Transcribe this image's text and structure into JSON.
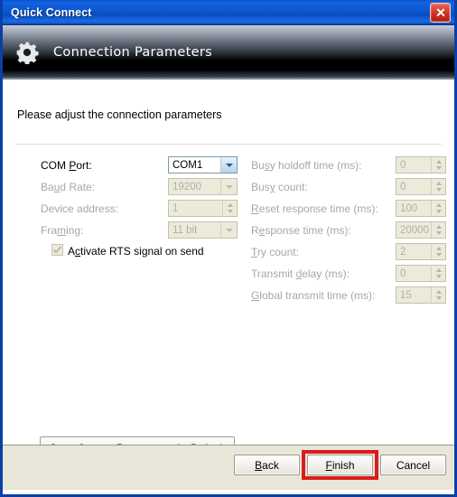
{
  "window": {
    "title": "Quick Connect",
    "close_icon": "close-icon"
  },
  "banner": {
    "icon": "gear-icon",
    "title": "Connection Parameters"
  },
  "intro": "Please adjust the connection parameters",
  "left_fields": [
    {
      "label_pre": "COM ",
      "label_acc": "P",
      "label_post": "ort:",
      "value": "COM1",
      "widget": "combo",
      "enabled": true
    },
    {
      "label_pre": "Ba",
      "label_acc": "u",
      "label_post": "d Rate:",
      "value": "19200",
      "widget": "combo",
      "enabled": false
    },
    {
      "label_pre": "Device address:",
      "label_acc": "",
      "label_post": "",
      "value": "1",
      "widget": "spinner",
      "enabled": false
    },
    {
      "label_pre": "Fra",
      "label_acc": "m",
      "label_post": "ing:",
      "value": "11 bit",
      "widget": "combo",
      "enabled": false
    }
  ],
  "checkbox": {
    "label_pre": "A",
    "label_acc": "c",
    "label_post": "tivate RTS signal on send",
    "checked": true,
    "enabled": false
  },
  "right_fields": [
    {
      "label_pre": "Bu",
      "label_acc": "s",
      "label_post": "y holdoff time (ms):",
      "value": "0",
      "widget": "spinner",
      "enabled": false
    },
    {
      "label_pre": "Bus",
      "label_acc": "y",
      "label_post": " count:",
      "value": "0",
      "widget": "spinner",
      "enabled": false
    },
    {
      "label_pre": "",
      "label_acc": "R",
      "label_post": "eset response time (ms):",
      "value": "100",
      "widget": "spinner",
      "enabled": false
    },
    {
      "label_pre": "R",
      "label_acc": "e",
      "label_post": "sponse time (ms):",
      "value": "20000",
      "widget": "spinner",
      "enabled": false
    },
    {
      "label_pre": "",
      "label_acc": "T",
      "label_post": "ry count:",
      "value": "2",
      "widget": "spinner",
      "enabled": false
    },
    {
      "label_pre": "Transmit ",
      "label_acc": "d",
      "label_post": "elay (ms):",
      "value": "0",
      "widget": "spinner",
      "enabled": false
    },
    {
      "label_pre": "",
      "label_acc": "G",
      "label_post": "lobal transmit time (ms):",
      "value": "15",
      "widget": "spinner",
      "enabled": false
    }
  ],
  "save_default_button": "Save Current Parameters As Default",
  "footer_buttons": [
    {
      "pre": "",
      "acc": "B",
      "post": "ack",
      "highlighted": false
    },
    {
      "pre": "",
      "acc": "F",
      "post": "inish",
      "highlighted": true
    },
    {
      "pre": "Cancel",
      "acc": "",
      "post": "",
      "highlighted": false
    }
  ],
  "colors": {
    "titlebar_blue": "#0b57d0",
    "dialog_border": "#0b3fa8",
    "footer_bg": "#e9e6d9",
    "disabled_field_bg": "#eceadb",
    "highlight_red": "#d91d1d",
    "close_red": "#d63a2a"
  }
}
